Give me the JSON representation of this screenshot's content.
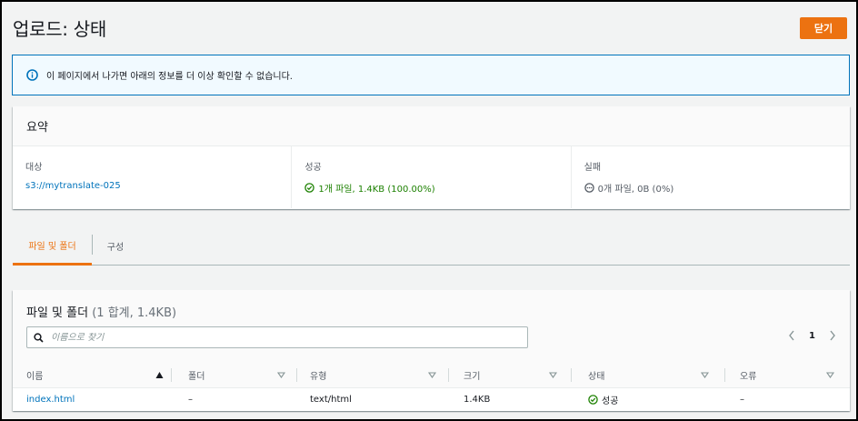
{
  "page": {
    "title": "업로드: 상태",
    "close_label": "닫기"
  },
  "alert": {
    "icon": "info-icon",
    "text": "이 페이지에서 나가면 아래의 정보를 더 이상 확인할 수 없습니다."
  },
  "summary": {
    "title": "요약",
    "destination": {
      "label": "대상",
      "value": "s3://mytranslate-025"
    },
    "succeeded": {
      "label": "성공",
      "value": "1개 파일, 1.4KB (100.00%)"
    },
    "failed": {
      "label": "실패",
      "value": "0개 파일, 0B (0%)"
    }
  },
  "tabs": [
    {
      "label": "파일 및 폴더",
      "active": true
    },
    {
      "label": "구성",
      "active": false
    }
  ],
  "files": {
    "title": "파일 및 폴더",
    "count": "(1 합계, 1.4KB)",
    "search_placeholder": "이름으로 찾기",
    "page": "1",
    "columns": [
      "이름",
      "폴더",
      "유형",
      "크기",
      "상태",
      "오류"
    ],
    "rows": [
      {
        "name": "index.html",
        "folder": "–",
        "type": "text/html",
        "size": "1.4KB",
        "status": "성공",
        "error": "–"
      }
    ]
  },
  "colors": {
    "accent": "#ec7211",
    "link": "#0073bb",
    "success": "#1d8102",
    "info_border": "#0073bb"
  }
}
